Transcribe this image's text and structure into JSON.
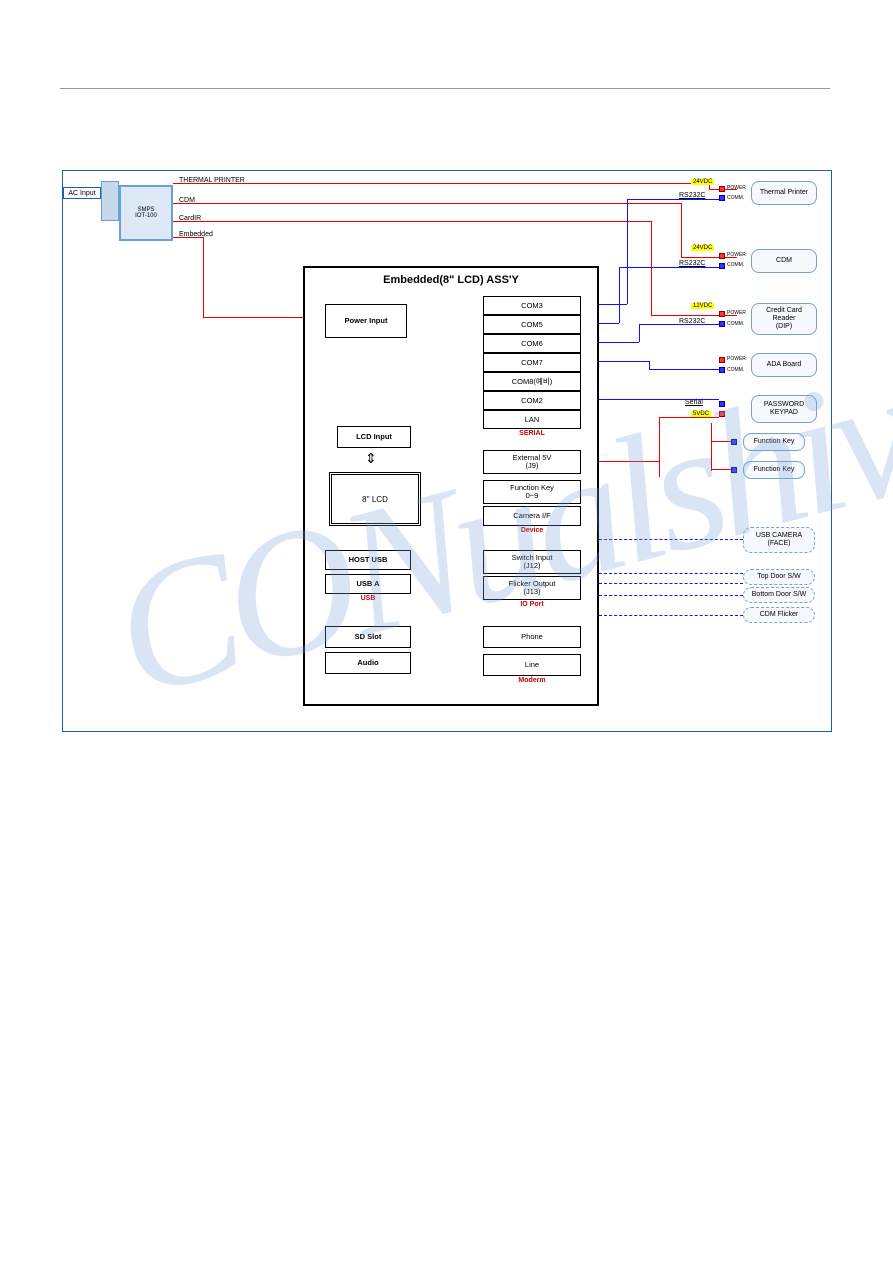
{
  "ac_input": "AC Input",
  "smps": "SMPS\nIOT-100",
  "smps_wires": {
    "tp": "THERMAL PRINTER",
    "cdm": "CDM",
    "cardir": "CardIR",
    "embedded": "Embedded"
  },
  "assy_title": "Embedded(8\" LCD) ASS'Y",
  "power_input": "Power Input",
  "serial_ports": [
    "COM3",
    "COM5",
    "COM6",
    "COM7",
    "COM8(예비)",
    "COM2",
    "LAN"
  ],
  "serial_label": "SERIAL",
  "external_5v": "External 5V\n(J9)",
  "function_key": "Function Key\n0~9",
  "camera_if": "Camera I/F",
  "device_label": "Device",
  "lcd_input": "LCD Input",
  "lcd_screen": "8'' LCD",
  "host_usb": "HOST USB",
  "usb_a": "USB A",
  "usb_label": "USB",
  "switch_input": "Switch Input\n(J12)",
  "flicker_output": "Flicker Output\n(J13)",
  "ioport_label": "IO Port",
  "phone": "Phone",
  "line": "Line",
  "modem_label": "Moderm",
  "sd_slot": "SD Slot",
  "audio": "Audio",
  "voltages": {
    "v24a": "24VDC",
    "v24b": "24VDC",
    "v12": "12VDC",
    "v5": "5VDC"
  },
  "conn_labels": {
    "rs232c": "RS232C",
    "power": "POWER",
    "comm": "COMM.",
    "serial": "Serial"
  },
  "peripherals": {
    "thermal_printer": "Thermal Printer",
    "cdm": "CDM",
    "card_reader": "Credit Card\nReader\n(DIP)",
    "ada_board": "ADA Board",
    "keypad": "PASSWORD\nKEYPAD",
    "fkey1": "Function Key",
    "fkey2": "Function Key",
    "usb_camera": "USB CAMERA\n(FACE)",
    "top_door": "Top Door S/W",
    "bottom_door": "Bottom Door S/W",
    "cdm_flicker": "CDM Flicker"
  }
}
